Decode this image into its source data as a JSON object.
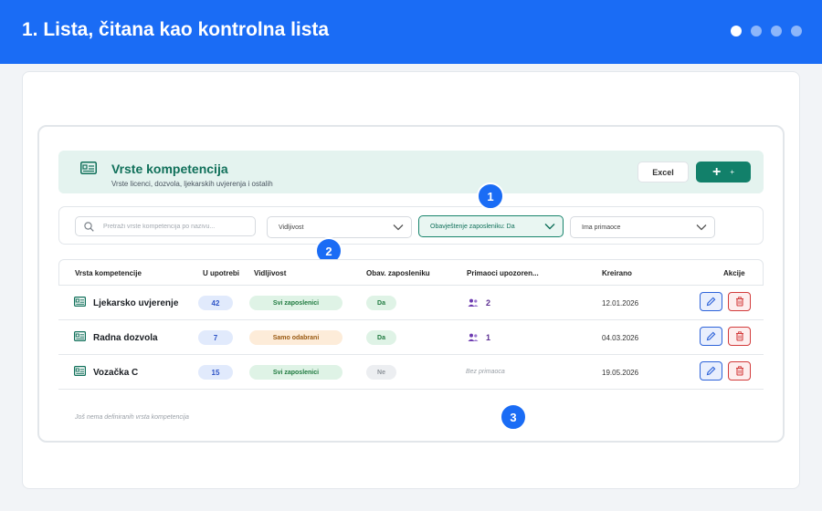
{
  "banner": {
    "title": "1. Lista, čitana kao kontrolna lista",
    "dots": [
      true,
      false,
      false,
      false
    ]
  },
  "header": {
    "title": "Vrste kompetencija",
    "subtitle": "Vrste licenci, dozvola, ljekarskih uvjerenja i ostalih",
    "excel_label": "Excel",
    "add_label": "+",
    "icon": "id-card-icon"
  },
  "filters": {
    "search_placeholder": "Pretraži vrste kompetencija po nazivu...",
    "visibility": "Vidljivost",
    "notify": "Obavještenje zaposleniku: Da",
    "has_receivers": "Ima primaoce"
  },
  "markers": [
    "1",
    "2",
    "3"
  ],
  "table": {
    "columns": [
      "Vrsta kompetencije",
      "U upotrebi",
      "Vidljivost",
      "Obav. zaposleniku",
      "Primaoci upozoren...",
      "Kreirano",
      "Akcije"
    ],
    "rows": [
      {
        "name": "Ljekarsko uvjerenje",
        "in_use": "42",
        "visibility": "Svi zaposlenici",
        "visibility_kind": "green",
        "notify": "Da",
        "notify_kind": "yes",
        "receivers": "2",
        "created": "12.01.2026"
      },
      {
        "name": "Radna dozvola",
        "in_use": "7",
        "visibility": "Samo odabrani",
        "visibility_kind": "orange",
        "notify": "Da",
        "notify_kind": "yes",
        "receivers": "1",
        "created": "04.03.2026"
      },
      {
        "name": "Vozačka C",
        "in_use": "15",
        "visibility": "Svi zaposlenici",
        "visibility_kind": "green",
        "notify": "Ne",
        "notify_kind": "no",
        "receivers_none": "Bez primaoca",
        "created": "19.05.2026"
      }
    ]
  },
  "empty_note": "Još nema definiranih vrsta kompetencija",
  "colors": {
    "banner": "#1a6cf5",
    "brand_green": "#12806a",
    "header_bg": "#e4f3ef",
    "edit": "#2d63d9",
    "delete": "#d23b3b"
  }
}
